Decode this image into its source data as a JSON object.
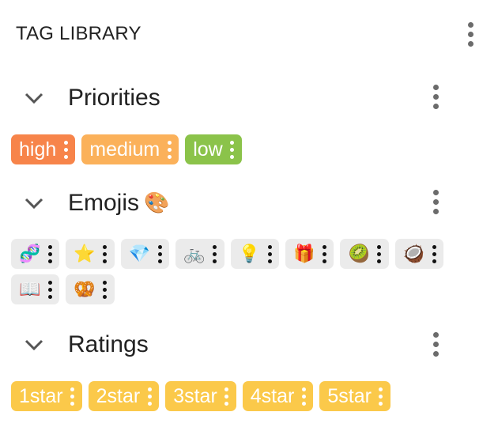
{
  "header": {
    "title": "TAG LIBRARY",
    "menu_icon": "more-vert-icon"
  },
  "groups": [
    {
      "name": "Priorities",
      "emoji": "",
      "tags": [
        {
          "label": "high",
          "color": "#f7844a"
        },
        {
          "label": "medium",
          "color": "#fbb15a"
        },
        {
          "label": "low",
          "color": "#8bc34a"
        }
      ]
    },
    {
      "name": "Emojis",
      "emoji": "🎨",
      "tags": [
        {
          "label": "🧬"
        },
        {
          "label": "⭐"
        },
        {
          "label": "💎"
        },
        {
          "label": "🚲"
        },
        {
          "label": "💡"
        },
        {
          "label": "🎁"
        },
        {
          "label": "🥝"
        },
        {
          "label": "🥥"
        },
        {
          "label": "📖"
        },
        {
          "label": "🥨"
        }
      ]
    },
    {
      "name": "Ratings",
      "emoji": "",
      "tags": [
        {
          "label": "1star",
          "color": "#fbc94a"
        },
        {
          "label": "2star",
          "color": "#fbc94a"
        },
        {
          "label": "3star",
          "color": "#fbc94a"
        },
        {
          "label": "4star",
          "color": "#fbc94a"
        },
        {
          "label": "5star",
          "color": "#fbc94a"
        }
      ]
    }
  ],
  "colors": {
    "emoji_chip_bg": "#ebebeb",
    "kebab": "#6b6b6b"
  }
}
